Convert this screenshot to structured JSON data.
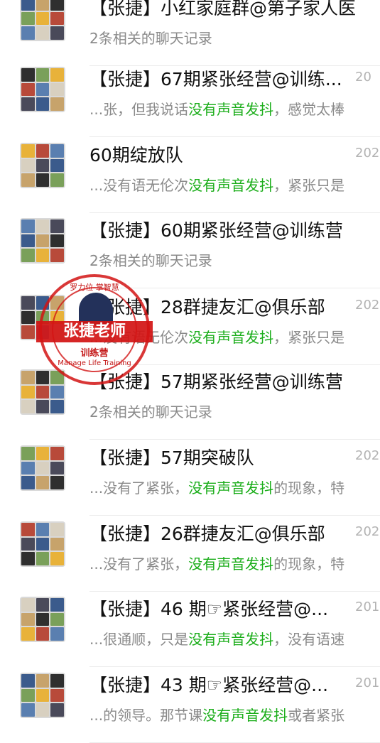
{
  "chats": [
    {
      "title": "【张捷】小红家庭群@第子家人医",
      "date": "",
      "sub_pre": "2条相关的聊天记录",
      "sub_hl": "",
      "sub_post": ""
    },
    {
      "title": "【张捷】67期紧张经营@训练...",
      "date": "20",
      "sub_pre": "...张，但我说话",
      "sub_hl": "没有声音发抖",
      "sub_post": "，感觉太棒"
    },
    {
      "title": "60期绽放队",
      "date": "202",
      "sub_pre": "...没有语无伦次",
      "sub_hl": "没有声音发抖",
      "sub_post": "，紧张只是"
    },
    {
      "title": "【张捷】60期紧张经营@训练营",
      "date": "",
      "sub_pre": "2条相关的聊天记录",
      "sub_hl": "",
      "sub_post": ""
    },
    {
      "title": "【张捷】28群捷友汇@俱乐部",
      "date": "202",
      "sub_pre": "...没有语无伦次",
      "sub_hl": "没有声音发抖",
      "sub_post": "，紧张只是"
    },
    {
      "title": "【张捷】57期紧张经营@训练营",
      "date": "",
      "sub_pre": "2条相关的聊天记录",
      "sub_hl": "",
      "sub_post": ""
    },
    {
      "title": "【张捷】57期突破队",
      "date": "202",
      "sub_pre": "...没有了紧张，",
      "sub_hl": "没有声音发抖",
      "sub_post": "的现象，特"
    },
    {
      "title": "【张捷】26群捷友汇@俱乐部",
      "date": "202",
      "sub_pre": "...没有了紧张，",
      "sub_hl": "没有声音发抖",
      "sub_post": "的现象，特"
    },
    {
      "title": "【张捷】46 期☞紧张经营@...",
      "date": "201",
      "sub_pre": "...很通顺，只是",
      "sub_hl": "没有声音发抖",
      "sub_post": "，没有语速"
    },
    {
      "title": "【张捷】43 期☞紧张经营@...",
      "date": "201",
      "sub_pre": "...的领导。那节课",
      "sub_hl": "没有声音发抖",
      "sub_post": "或者紧张"
    }
  ],
  "stamp": {
    "band": "张捷老师",
    "top": "罗力位 掌智慧",
    "mid": "训练营",
    "bottom": "Manage Life Training"
  },
  "colors": {
    "highlight": "#1aad19",
    "stamp_red": "#d21414"
  }
}
